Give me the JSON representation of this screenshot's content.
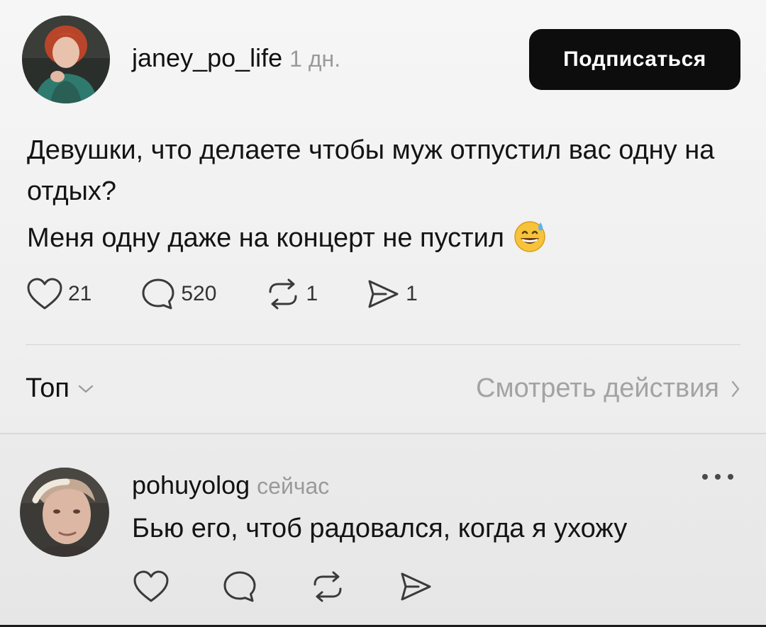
{
  "post": {
    "author": {
      "username": "janey_po_life",
      "time": "1 дн."
    },
    "follow_label": "Подписаться",
    "text_lines": [
      "Девушки, что делаете чтобы муж отпустил вас одну на отдых?",
      "Меня одну даже на концерт не пустил"
    ],
    "emoji": "grinning-face-with-sweat",
    "stats": {
      "likes": "21",
      "comments": "520",
      "reposts": "1",
      "shares": "1"
    }
  },
  "sort": {
    "label": "Топ",
    "view_activity_label": "Смотреть действия"
  },
  "reply": {
    "author": {
      "username": "pohuyolog",
      "time": "сейчас"
    },
    "text": "Бью его, чтоб радовался, когда я ухожу"
  },
  "icons": {
    "like": "heart-icon",
    "comment": "comment-bubble-icon",
    "repost": "repost-icon",
    "share": "send-icon",
    "chevron_down": "chevron-down-icon",
    "chevron_right": "chevron-right-icon",
    "more": "more-options-icon"
  },
  "colors": {
    "follow_button": "#0d0d0d",
    "muted_text": "#9a9a9a"
  }
}
